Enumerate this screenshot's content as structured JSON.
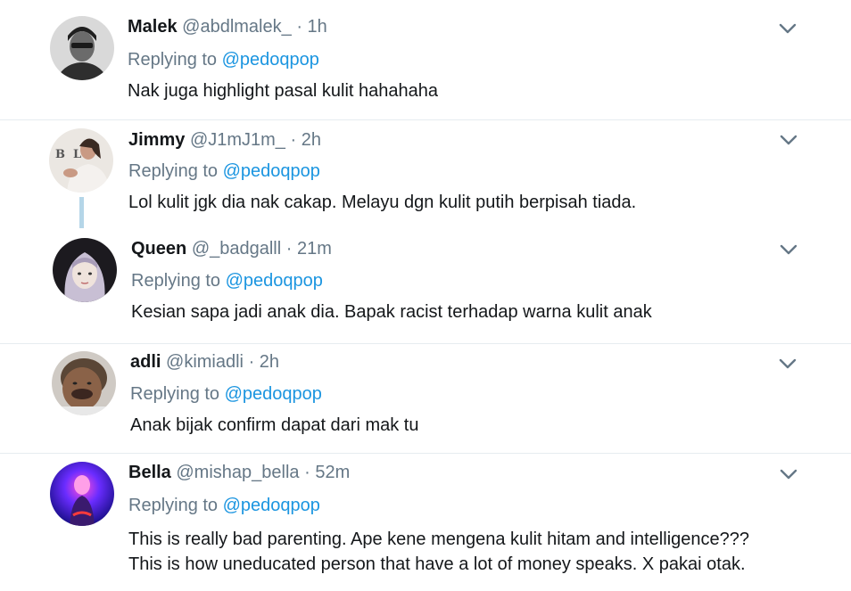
{
  "replies": [
    {
      "name": "Malek",
      "handle": "@abdlmalek_",
      "separator": "·",
      "time": "1h",
      "replying_prefix": "Replying to",
      "replying_to": "@pedoqpop",
      "text": "Nak juga highlight pasal kulit hahahaha"
    },
    {
      "name": "Jimmy",
      "handle": "@J1mJ1m_",
      "separator": "·",
      "time": "2h",
      "replying_prefix": "Replying to",
      "replying_to": "@pedoqpop",
      "text": "Lol kulit jgk dia nak cakap. Melayu dgn kulit putih berpisah tiada."
    },
    {
      "name": "Queen",
      "handle": "@_badgalll",
      "separator": "·",
      "time": "21m",
      "replying_prefix": "Replying to",
      "replying_to": "@pedoqpop",
      "text": "Kesian sapa jadi anak dia. Bapak racist terhadap warna kulit anak"
    },
    {
      "name": "adli",
      "handle": "@kimiadli",
      "separator": "·",
      "time": "2h",
      "replying_prefix": "Replying to",
      "replying_to": "@pedoqpop",
      "text": "Anak bijak confirm dapat dari mak tu"
    },
    {
      "name": "Bella",
      "handle": "@mishap_bella",
      "separator": "·",
      "time": "52m",
      "replying_prefix": "Replying to",
      "replying_to": "@pedoqpop",
      "text": "This is really bad parenting. Ape kene mengena kulit hitam and intelligence???\nThis is how uneducated person that have a lot of money speaks. X pakai otak."
    }
  ],
  "colors": {
    "name": "#14171a",
    "meta": "#657786",
    "link": "#1b95e0",
    "divider": "#e6ecf0",
    "thread_line": "#b5d6e8"
  },
  "icons": {
    "menu": "chevron-down-icon"
  }
}
